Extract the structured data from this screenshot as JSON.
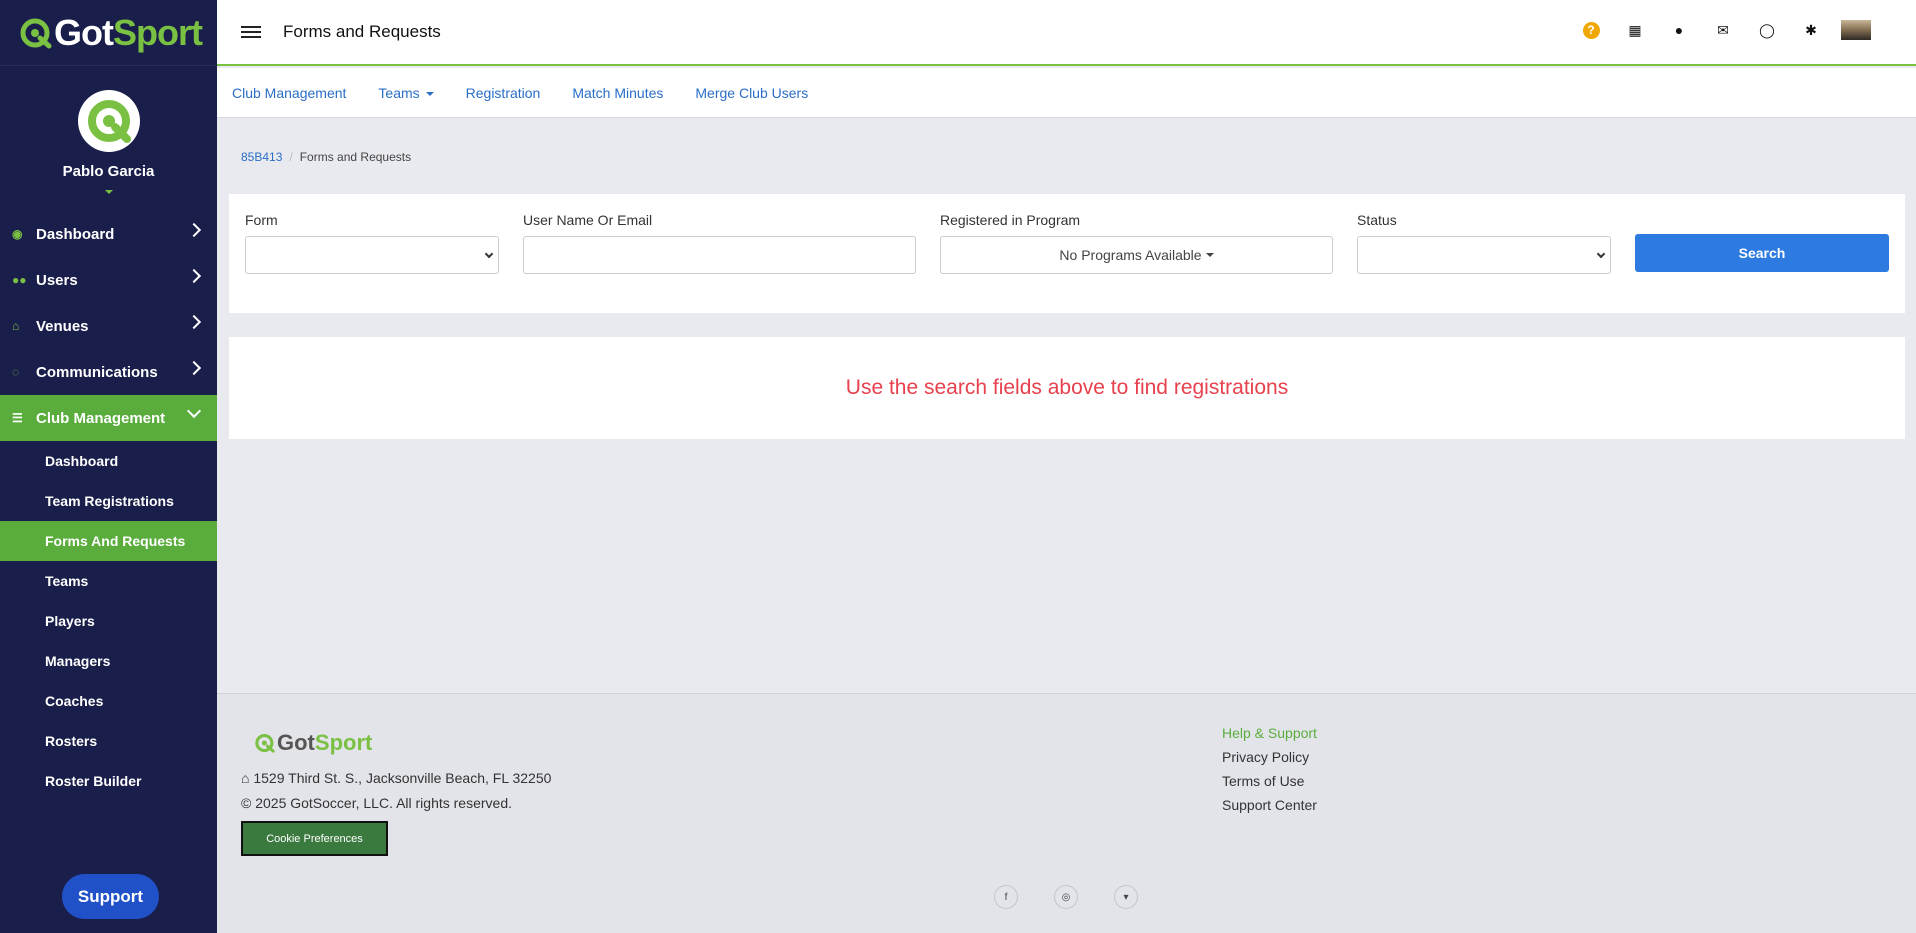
{
  "brand": {
    "got": "Got",
    "sport": "Sport"
  },
  "profile": {
    "name": "Pablo Garcia"
  },
  "sidebar": {
    "items": [
      {
        "label": "Dashboard",
        "icon": "dashboard-icon"
      },
      {
        "label": "Users",
        "icon": "users-icon"
      },
      {
        "label": "Venues",
        "icon": "home-icon"
      },
      {
        "label": "Communications",
        "icon": "chat-icon"
      },
      {
        "label": "Club Management",
        "icon": "list-icon"
      }
    ],
    "subitems": [
      {
        "label": "Dashboard"
      },
      {
        "label": "Team Registrations"
      },
      {
        "label": "Forms And Requests"
      },
      {
        "label": "Teams"
      },
      {
        "label": "Players"
      },
      {
        "label": "Managers"
      },
      {
        "label": "Coaches"
      },
      {
        "label": "Rosters"
      },
      {
        "label": "Roster Builder"
      }
    ],
    "support_label": "Support"
  },
  "header": {
    "title": "Forms and Requests",
    "icons": [
      "help-icon",
      "qr-code-icon",
      "user-icon",
      "envelope-icon",
      "chat-icon",
      "gear-icon"
    ]
  },
  "subnav": {
    "items": [
      {
        "label": "Club Management"
      },
      {
        "label": "Teams"
      },
      {
        "label": "Registration"
      },
      {
        "label": "Match Minutes"
      },
      {
        "label": "Merge Club Users"
      }
    ]
  },
  "breadcrumb": {
    "root": "85B413",
    "current": "Forms and Requests"
  },
  "filters": {
    "form_label": "Form",
    "form_value": "",
    "user_label": "User Name Or Email",
    "user_value": "",
    "program_label": "Registered in Program",
    "program_value": "No Programs Available",
    "status_label": "Status",
    "status_value": "",
    "search_label": "Search"
  },
  "message": "Use the search fields above to find registrations",
  "footer": {
    "address": "1529 Third St. S., Jacksonville Beach, FL 32250",
    "copyright": "© 2025 GotSoccer, LLC. All rights reserved.",
    "cookie_label": "Cookie Preferences",
    "links": {
      "help": "Help & Support",
      "privacy": "Privacy Policy",
      "terms": "Terms of Use",
      "support_center": "Support Center"
    },
    "socials": [
      "facebook-icon",
      "instagram-icon",
      "twitter-icon"
    ]
  },
  "colors": {
    "sidebar_bg": "#1a1e4a",
    "accent_green": "#5aad3c",
    "link_blue": "#2a6ec6",
    "button_blue": "#2d7be0",
    "message_red": "#e8414e"
  }
}
